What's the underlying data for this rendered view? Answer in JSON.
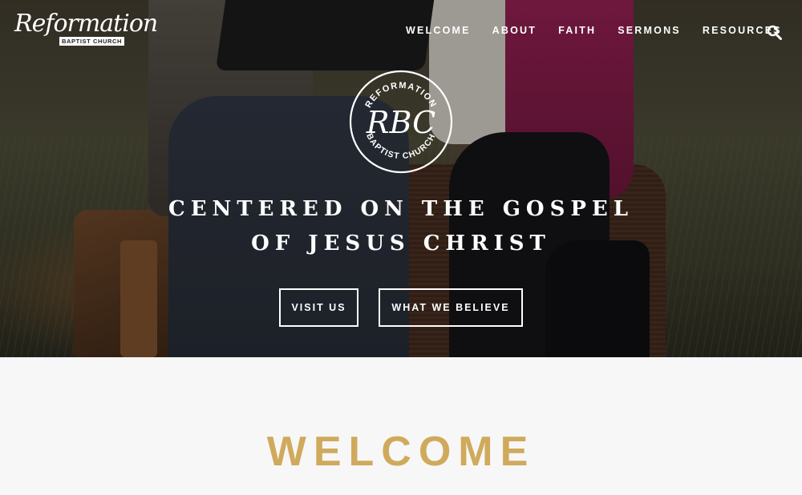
{
  "site": {
    "logo_script": "Reformation",
    "logo_subtitle": "BAPTIST CHURCH"
  },
  "nav": {
    "items": [
      {
        "label": "WELCOME"
      },
      {
        "label": "ABOUT"
      },
      {
        "label": "FAITH"
      },
      {
        "label": "SERMONS"
      },
      {
        "label": "RESOURCES"
      }
    ],
    "search_icon": "search-icon"
  },
  "emblem": {
    "top_text": "REFORMATION",
    "monogram": "RBC",
    "bottom_text": "BAPTIST CHURCH"
  },
  "hero": {
    "headline_line1": "CENTERED ON THE GOSPEL",
    "headline_line2": "OF JESUS CHRIST",
    "buttons": {
      "visit": "VISIT US",
      "believe": "WHAT WE BELIEVE"
    }
  },
  "welcome": {
    "title": "WELCOME"
  },
  "colors": {
    "accent_gold": "#d0aa5c",
    "text_white": "#ffffff",
    "page_bg": "#f7f7f7"
  }
}
